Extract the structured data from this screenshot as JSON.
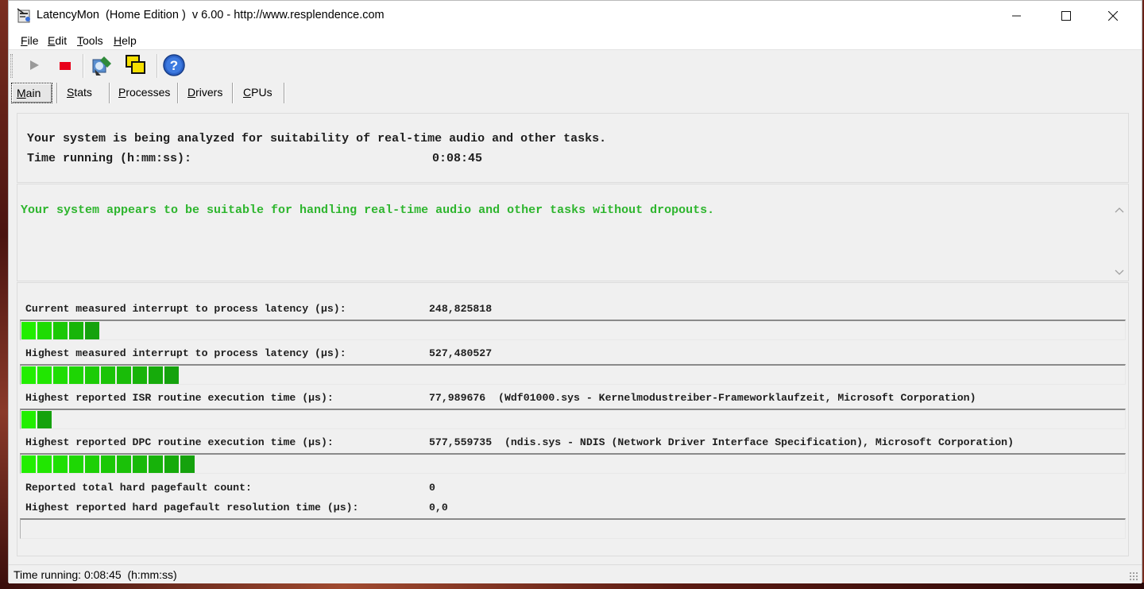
{
  "window": {
    "title": "LatencyMon  (Home Edition )  v 6.00 - http://www.resplendence.com",
    "minimize_icon": "minimize-icon",
    "maximize_icon": "maximize-icon",
    "close_icon": "close-icon"
  },
  "menu": [
    {
      "label": "File",
      "accel": "F",
      "rest": "ile"
    },
    {
      "label": "Edit",
      "accel": "E",
      "rest": "dit"
    },
    {
      "label": "Tools",
      "accel": "T",
      "rest": "ools"
    },
    {
      "label": "Help",
      "accel": "H",
      "rest": "elp"
    }
  ],
  "toolbar": {
    "play_icon": "play-icon",
    "stop_icon": "stop-icon",
    "kernel_icon": "kernel-timer-icon",
    "windows_icon": "windows-icon",
    "help_icon": "help-icon"
  },
  "tabs": [
    {
      "label": "Main",
      "accel": "M",
      "rest": "ain",
      "active": true
    },
    {
      "label": "Stats",
      "accel": "S",
      "rest": "tats",
      "active": false
    },
    {
      "label": "Processes",
      "accel": "P",
      "rest": "rocesses",
      "active": false
    },
    {
      "label": "Drivers",
      "accel": "D",
      "rest": "rivers",
      "active": false
    },
    {
      "label": "CPUs",
      "accel": "C",
      "rest": "PUs",
      "active": false
    }
  ],
  "analysis": {
    "message": "Your system is being analyzed for suitability of real-time audio and other tasks.",
    "time_label": "Time running (h:mm:ss):",
    "time_value": "0:08:45"
  },
  "result": {
    "message": "Your system appears to be suitable for handling real-time audio and other tasks without dropouts.",
    "color": "#2db52d"
  },
  "metrics": [
    {
      "label": "Current measured interrupt to process latency (µs):",
      "value": "248,825818",
      "segments": 5
    },
    {
      "label": "Highest measured interrupt to process latency (µs):",
      "value": "527,480527",
      "segments": 10
    },
    {
      "label": "Highest reported ISR routine execution time (µs):",
      "value": "77,989676  (Wdf01000.sys - Kernelmodustreiber-Frameworklaufzeit, Microsoft Corporation)",
      "segments": 2
    },
    {
      "label": "Highest reported DPC routine execution time (µs):",
      "value": "577,559735  (ndis.sys - NDIS (Network Driver Interface Specification), Microsoft Corporation)",
      "segments": 11
    },
    {
      "label": "Reported total hard pagefault count:",
      "value": "0"
    },
    {
      "label": "Highest reported hard pagefault resolution time (µs):",
      "value": "0,0",
      "segments": 0
    }
  ],
  "status": {
    "text": "Time running: 0:08:45  (h:mm:ss)"
  },
  "colors": {
    "bar_bright": "#22ee00",
    "bar_dark": "#139a0e"
  }
}
